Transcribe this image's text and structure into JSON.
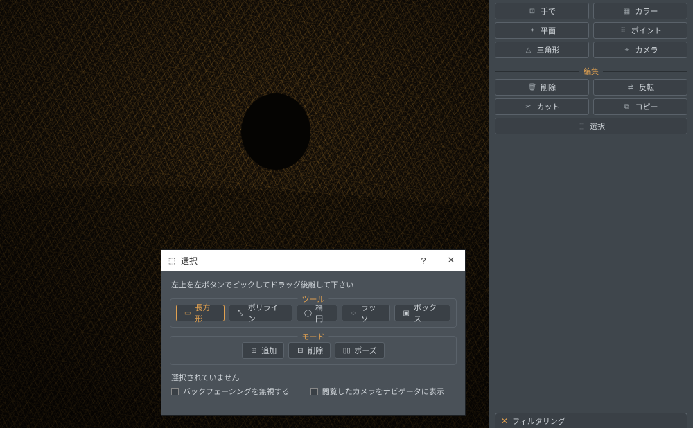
{
  "sidebar": {
    "row1": {
      "a": "手で",
      "b": "カラー"
    },
    "row2": {
      "a": "平面",
      "b": "ポイント"
    },
    "row3": {
      "a": "三角形",
      "b": "カメラ"
    },
    "edit_section": "編集",
    "edit_row1": {
      "a": "削除",
      "b": "反転"
    },
    "edit_row2": {
      "a": "カット",
      "b": "コピー"
    },
    "edit_row3": {
      "a": "選択"
    },
    "filter_tab": "フィルタリング"
  },
  "dialog": {
    "title": "選択",
    "instruction": "左上を左ボタンでピックしてドラッグ後離して下さい",
    "tools_legend": "ツール",
    "tools": {
      "rect": "長方形",
      "polyline": "ポリライン",
      "ellipse": "楕円",
      "lasso": "ラッソ",
      "box": "ボックス"
    },
    "mode_legend": "モード",
    "modes": {
      "add": "追加",
      "remove": "削除",
      "pause": "ポーズ"
    },
    "status": "選択されていません",
    "chk_backface": "バックフェーシングを無視する",
    "chk_navigator": "閲覧したカメラをナビゲータに表示"
  }
}
